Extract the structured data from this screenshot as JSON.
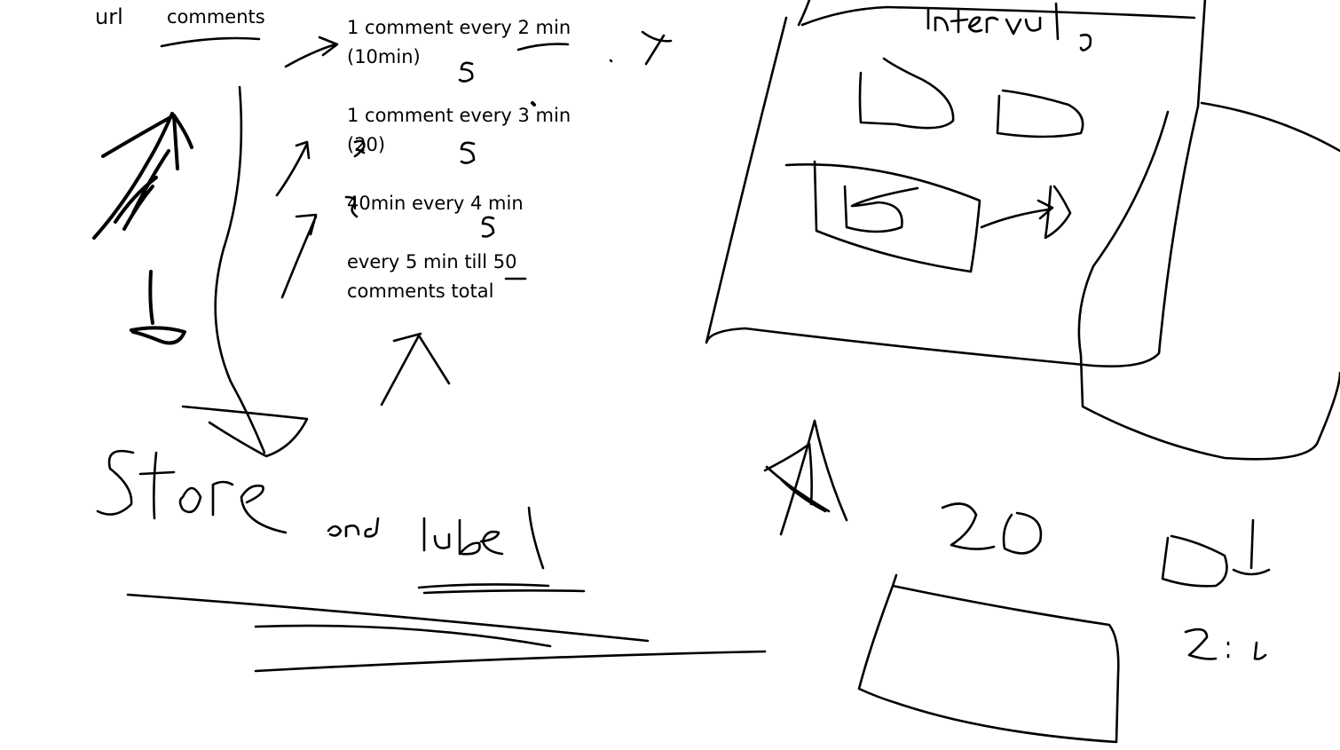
{
  "canvas": {
    "background_color": "#ffffff",
    "ink_color": "#000000"
  },
  "headers": {
    "url_label": "url",
    "comments_label": "comments"
  },
  "notes": [
    {
      "line1": "1 comment every 2 min",
      "line2": "(10min)"
    },
    {
      "line1": "1 comment every 3 min",
      "line2": "(20)"
    },
    {
      "line1": "40min every 4 min",
      "line2": ""
    },
    {
      "line1": "every 5 min till 50",
      "line2": "comments total"
    }
  ]
}
